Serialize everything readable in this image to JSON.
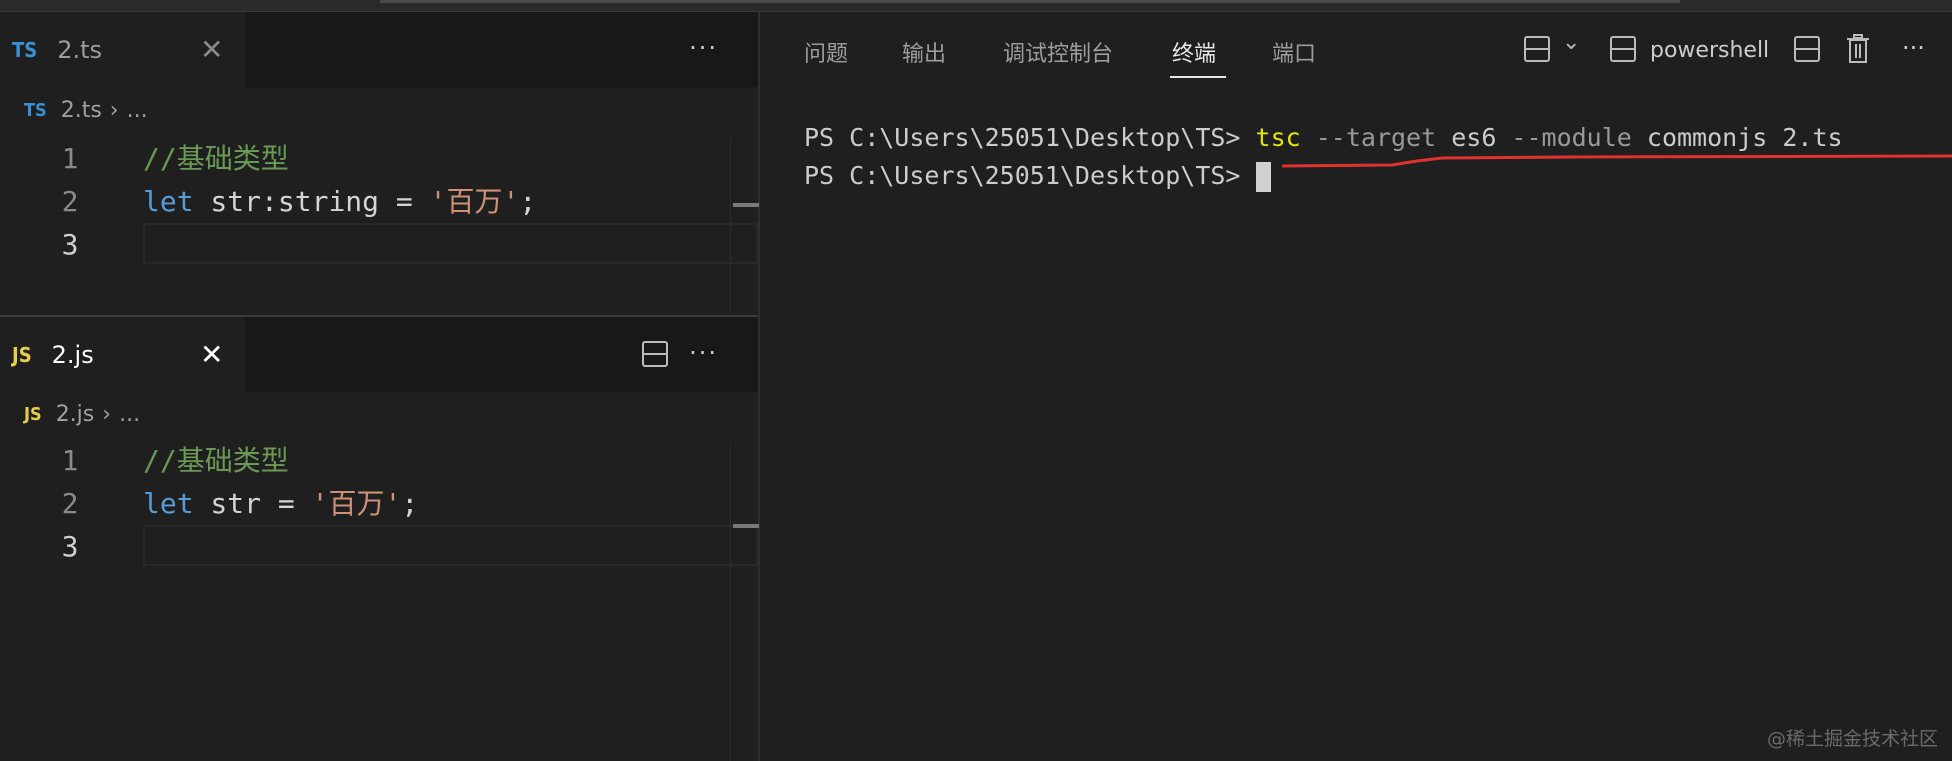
{
  "ts_editor": {
    "tab": {
      "lang": "TS",
      "name": "2.ts",
      "close": "✕"
    },
    "more": "···",
    "breadcrumb": {
      "lang": "TS",
      "file": "2.ts",
      "sep": "›",
      "rest": "..."
    },
    "lines": [
      {
        "n": "1",
        "comment": "//基础类型"
      },
      {
        "n": "2",
        "kw": "let",
        "mid": " str:string = ",
        "str": "'百万'",
        "end": ";"
      },
      {
        "n": "3"
      }
    ]
  },
  "js_editor": {
    "tab": {
      "lang": "JS",
      "name": "2.js",
      "close": "✕"
    },
    "more": "···",
    "breadcrumb": {
      "lang": "JS",
      "file": "2.js",
      "sep": "›",
      "rest": "..."
    },
    "lines": [
      {
        "n": "1",
        "comment": "//基础类型"
      },
      {
        "n": "2",
        "kw": "let",
        "mid": " str = ",
        "str": "'百万'",
        "end": ";"
      },
      {
        "n": "3"
      }
    ]
  },
  "panel": {
    "tabs": [
      "问题",
      "输出",
      "调试控制台",
      "终端",
      "端口"
    ],
    "active": "终端",
    "shell": "powershell",
    "more": "···",
    "chevron": "⌄"
  },
  "terminal": {
    "prompt": "PS C:\\Users\\25051\\Desktop\\TS> ",
    "cmd": "tsc",
    "arg1": " --target ",
    "v1": "es6",
    "arg2": " --module ",
    "v2": "commonjs 2.ts"
  },
  "watermark": "@稀土掘金技术社区",
  "colors": {
    "annotation": "#e0312f"
  }
}
